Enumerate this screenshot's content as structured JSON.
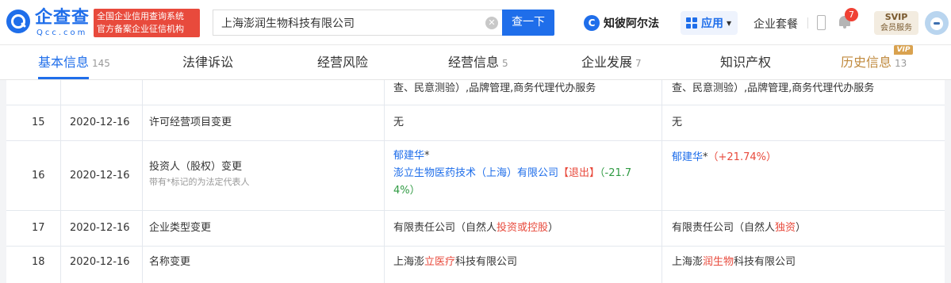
{
  "header": {
    "logo_cn": "企查查",
    "logo_en": "Qcc.com",
    "slogan_line1": "全国企业信用查询系统",
    "slogan_line2": "官方备案企业征信机构",
    "search_value": "上海澎润生物科技有限公司",
    "clear_glyph": "✕",
    "search_button": "查一下",
    "zhibi_icon_letter": "C",
    "zhibi_label": "知彼阿尔法",
    "app_label": "应用",
    "caret": "▼",
    "suite_label": "企业套餐",
    "notification_count": "7",
    "svip_top": "SVIP",
    "svip_bottom": "会员服务"
  },
  "tabs": [
    {
      "label": "基本信息",
      "count": "145"
    },
    {
      "label": "法律诉讼",
      "count": ""
    },
    {
      "label": "经营风险",
      "count": ""
    },
    {
      "label": "经营信息",
      "count": "5"
    },
    {
      "label": "企业发展",
      "count": "7"
    },
    {
      "label": "知识产权",
      "count": ""
    },
    {
      "label": "历史信息",
      "count": "13"
    }
  ],
  "vip_tag": "VIP",
  "table": {
    "partial_row": {
      "before": "查、民意测验）,品牌管理,商务代理代办服务",
      "after": "查、民意测验）,品牌管理,商务代理代办服务"
    },
    "rows": [
      {
        "no": "15",
        "date": "2020-12-16",
        "item": "许可经营项目变更",
        "before": "无",
        "after": "无"
      },
      {
        "no": "16",
        "date": "2020-12-16",
        "item": "投资人（股权）变更",
        "item_hint": "带有*标记的为法定代表人",
        "before_person": "郁建华",
        "before_person_mark": "*",
        "before_company": "澎立生物医药技术（上海）有限公司",
        "before_exit": "【退出】",
        "before_pct_line1": "（-21.7",
        "before_pct_line2": "4%）",
        "after_person": "郁建华",
        "after_person_mark": "*",
        "after_pct": "（+21.74%）"
      },
      {
        "no": "17",
        "date": "2020-12-16",
        "item": "企业类型变更",
        "before_prefix": "有限责任公司（自然人",
        "before_highlight": "投资或控股",
        "before_suffix": "）",
        "after_prefix": "有限责任公司（自然人",
        "after_highlight": "独资",
        "after_suffix": "）"
      },
      {
        "no": "18",
        "date": "2020-12-16",
        "item": "名称变更",
        "before_prefix": "上海澎",
        "before_highlight": "立医疗",
        "before_suffix": "科技有限公司",
        "after_prefix": "上海澎",
        "after_highlight": "润生物",
        "after_suffix": "科技有限公司"
      }
    ]
  },
  "colors": {
    "brand_blue": "#1f6eea",
    "highlight_red": "#e84a3c",
    "decrease_green": "#2f9a42",
    "history_gold": "#c08a3e"
  }
}
